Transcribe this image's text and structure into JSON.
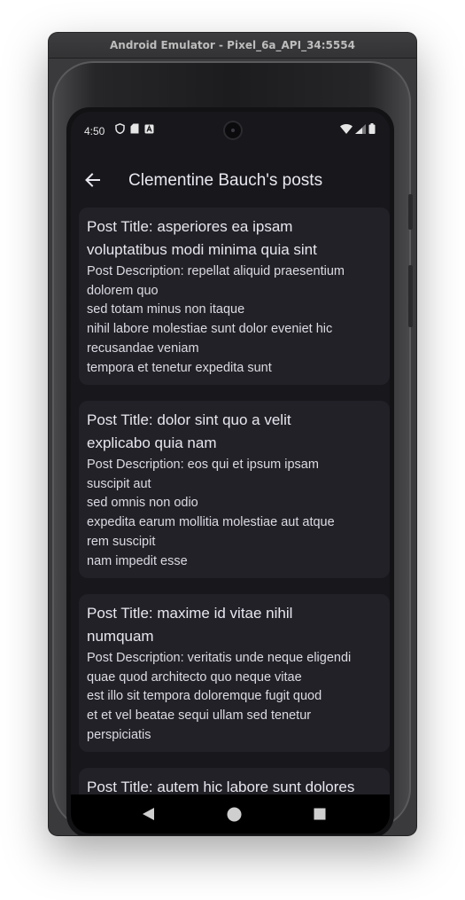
{
  "window": {
    "title": "Android Emulator - Pixel_6a_API_34:5554"
  },
  "statusbar": {
    "time": "4:50"
  },
  "appbar": {
    "title": "Clementine Bauch's posts"
  },
  "posts": [
    {
      "title": "Post Title: asperiores ea ipsam\nvoluptatibus modi minima quia sint",
      "description": "Post Description: repellat aliquid praesentium\ndolorem quo\nsed totam minus non itaque\nnihil labore molestiae sunt dolor eveniet hic\nrecusandae veniam\ntempora et tenetur expedita sunt"
    },
    {
      "title": "Post Title: dolor sint quo a velit\nexplicabo quia nam",
      "description": "Post Description: eos qui et ipsum ipsam\nsuscipit aut\nsed omnis non odio\nexpedita earum mollitia molestiae aut atque\nrem suscipit\nnam impedit esse"
    },
    {
      "title": "Post Title: maxime id vitae nihil\nnumquam",
      "description": "Post Description: veritatis unde neque eligendi\nquae quod architecto quo neque vitae\nest illo sit tempora doloremque fugit quod\net et vel beatae sequi ullam sed tenetur\nperspiciatis"
    },
    {
      "title": "Post Title: autem hic labore sunt dolores\nincidunt",
      "description": ""
    }
  ],
  "icons": {
    "statusbar_left": [
      "shield-icon",
      "sim-card-icon",
      "text-a-icon"
    ],
    "statusbar_right": [
      "wifi-icon",
      "cell-signal-icon",
      "battery-icon"
    ],
    "navbar": [
      "back-triangle-icon",
      "home-circle-icon",
      "recents-square-icon"
    ]
  },
  "colors": {
    "background": "#18171c",
    "card": "#222128",
    "text": "#e8e6ee"
  }
}
